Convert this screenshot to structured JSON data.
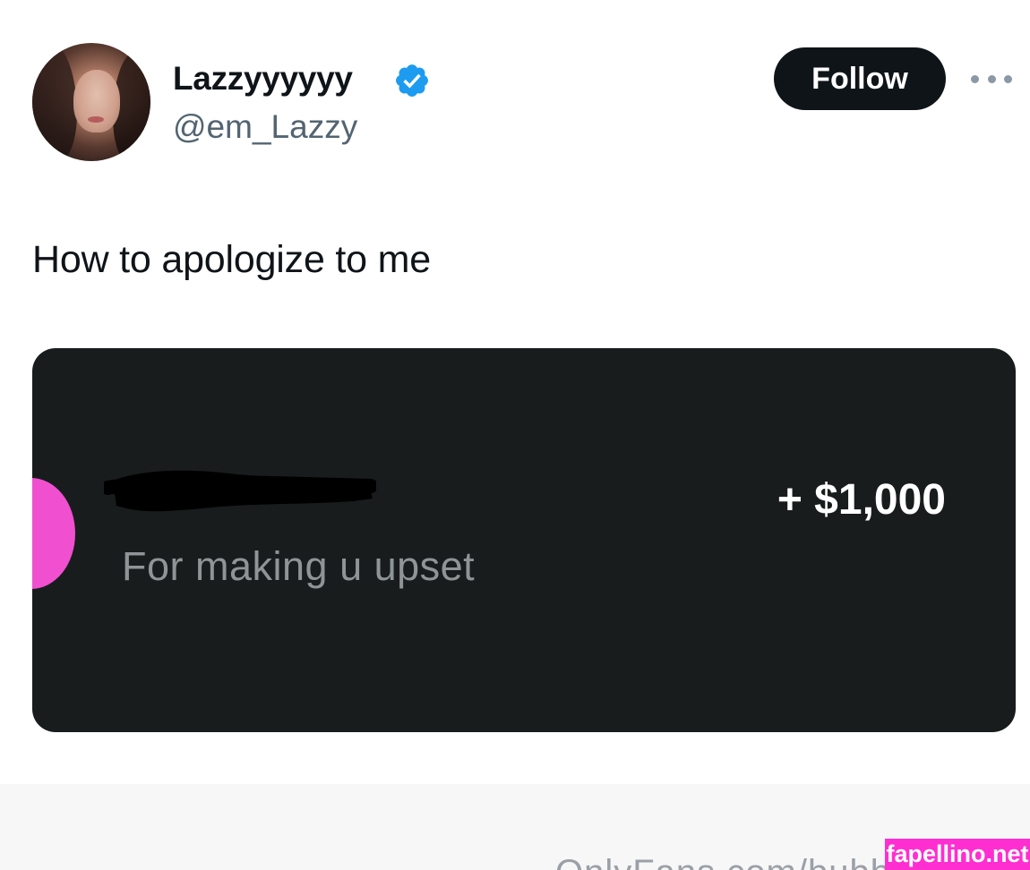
{
  "tweet": {
    "display_name": "Lazzyyyyyy",
    "handle": "@em_Lazzy",
    "verified_icon": "verified-badge-icon",
    "follow_label": "Follow",
    "more_icon": "more-options-icon",
    "text": "How to apologize to me"
  },
  "media_card": {
    "memo": "For making u upset",
    "amount": "+ $1,000",
    "avatar_color": "#f04fcf",
    "background_color": "#191c1d"
  },
  "footer": {
    "text": "OnlyFans.com/bubb"
  },
  "watermark": {
    "text": "fapellino.net",
    "color": "#ff2ed1"
  },
  "colors": {
    "follow_button_bg": "#0f1419",
    "verified_blue": "#1d9bf0",
    "handle_gray": "#536471"
  }
}
